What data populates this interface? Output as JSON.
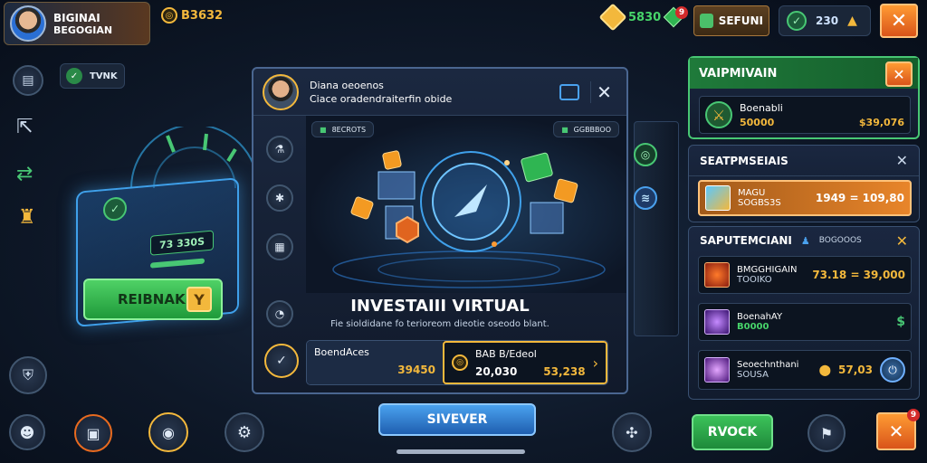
{
  "profile": {
    "name_line1": "BIGINAI",
    "name_line2": "BEGOGIAN"
  },
  "top_currency": {
    "value": "B3632"
  },
  "top_right": {
    "gems_value": "5830",
    "notif_count": "9",
    "shop_label": "SEFUNI",
    "shield_value": "230"
  },
  "left_status": {
    "label": "TVNK"
  },
  "left_card": {
    "value": "73 330S",
    "button_label": "REIBNAK"
  },
  "modal": {
    "title_line1": "Diana oeoenos",
    "title_line2": "Ciace oradendraiterfin obide",
    "tag_left": "8ECROTS",
    "tag_right": "GGBBBOO",
    "heading": "INVESTAIII VIRTUAL",
    "description": "Fie sioldidane  fo terioreom dieotie oseodo blant.",
    "row_left_label": "BoendAces",
    "row_left_value": "39450",
    "row_right_label": "BAB B/Edeol",
    "row_right_value1": "20,030",
    "row_right_value2": "53,238",
    "main_button": "SIVEVER"
  },
  "right_panel": {
    "section1_title": "VAIPMIVAIN",
    "section1_item_name": "Boenabli",
    "section1_item_val1": "50000",
    "section1_item_val2": "$39,076",
    "section2_title": "SEATPMSEIAIS",
    "section2_item_name": "MAGU",
    "section2_item_sub": "SOGBS3S",
    "section2_item_val": "1949 = 109,80",
    "section3_title": "SAPUTEMCIANI",
    "section3_tag": "BOGOOOS",
    "section3_item1_name": "BMGGHIGAIN",
    "section3_item1_sub": "TOOIKO",
    "section3_item1_val": "73.18 = 39,000",
    "section3_item2_name": "BoenahAY",
    "section3_item2_sub": "B0000",
    "section3_item3_name": "Seoechnthani",
    "section3_item3_sub": "SOUSA",
    "section3_item3_val": "57,03"
  },
  "bottom": {
    "right_button": "RVOCK",
    "right_notif": "9"
  },
  "colors": {
    "accent_orange": "#e86a1f",
    "accent_green": "#3bc25a",
    "accent_blue": "#2f7fd6",
    "gold": "#f3b83c"
  }
}
